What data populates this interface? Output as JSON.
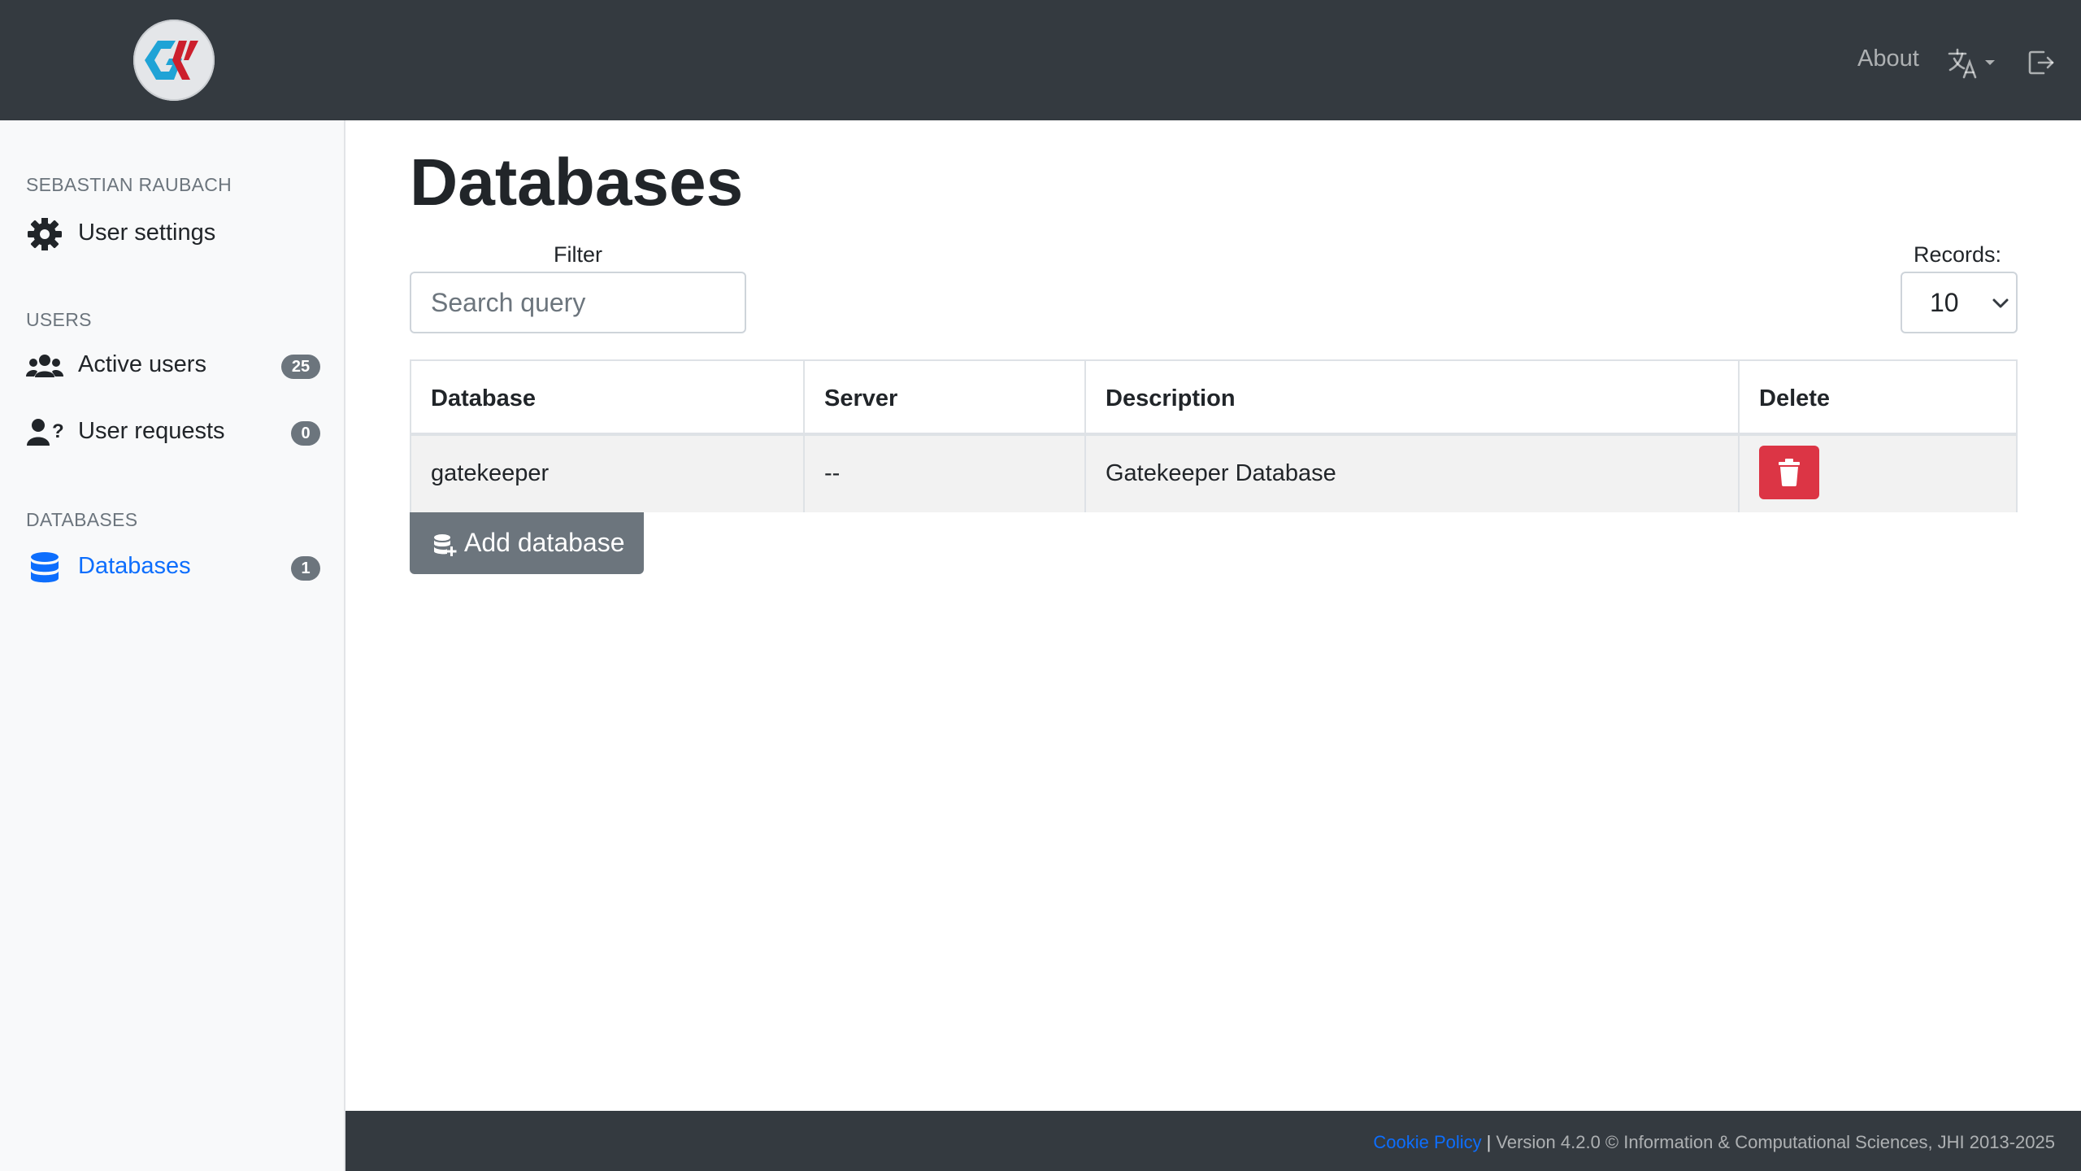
{
  "navbar": {
    "logo_text": "GK",
    "about_label": "About",
    "language_icon": "translate-icon",
    "logout_icon": "sign-out-icon"
  },
  "sidebar": {
    "user_heading": "SEBASTIAN RAUBACH",
    "user_settings": {
      "label": "User settings",
      "icon": "gear-icon"
    },
    "users_heading": "USERS",
    "active_users": {
      "label": "Active users",
      "count": "25",
      "icon": "users-icon"
    },
    "user_requests": {
      "label": "User requests",
      "count": "0",
      "icon": "user-question-icon"
    },
    "databases_heading": "DATABASES",
    "databases": {
      "label": "Databases",
      "count": "1",
      "icon": "database-icon"
    }
  },
  "main": {
    "title": "Databases",
    "filter_label": "Filter",
    "search_placeholder": "Search query",
    "records_label": "Records:",
    "records_value": "10",
    "table": {
      "headers": [
        "Database",
        "Server",
        "Description",
        "Delete"
      ],
      "rows": [
        {
          "database": "gatekeeper",
          "server": "--",
          "description": "Gatekeeper Database"
        }
      ]
    },
    "add_button_label": "Add database"
  },
  "footer": {
    "cookie_link": "Cookie Policy",
    "separator": "|",
    "version_text": "Version 4.2.0 © Information & Computational Sciences, JHI 2013-2025"
  },
  "colors": {
    "navbar": "#343a40",
    "sidebar": "#f8f9fa",
    "primary": "#0d6efd",
    "danger": "#dc3545",
    "secondary": "#6c757d"
  }
}
